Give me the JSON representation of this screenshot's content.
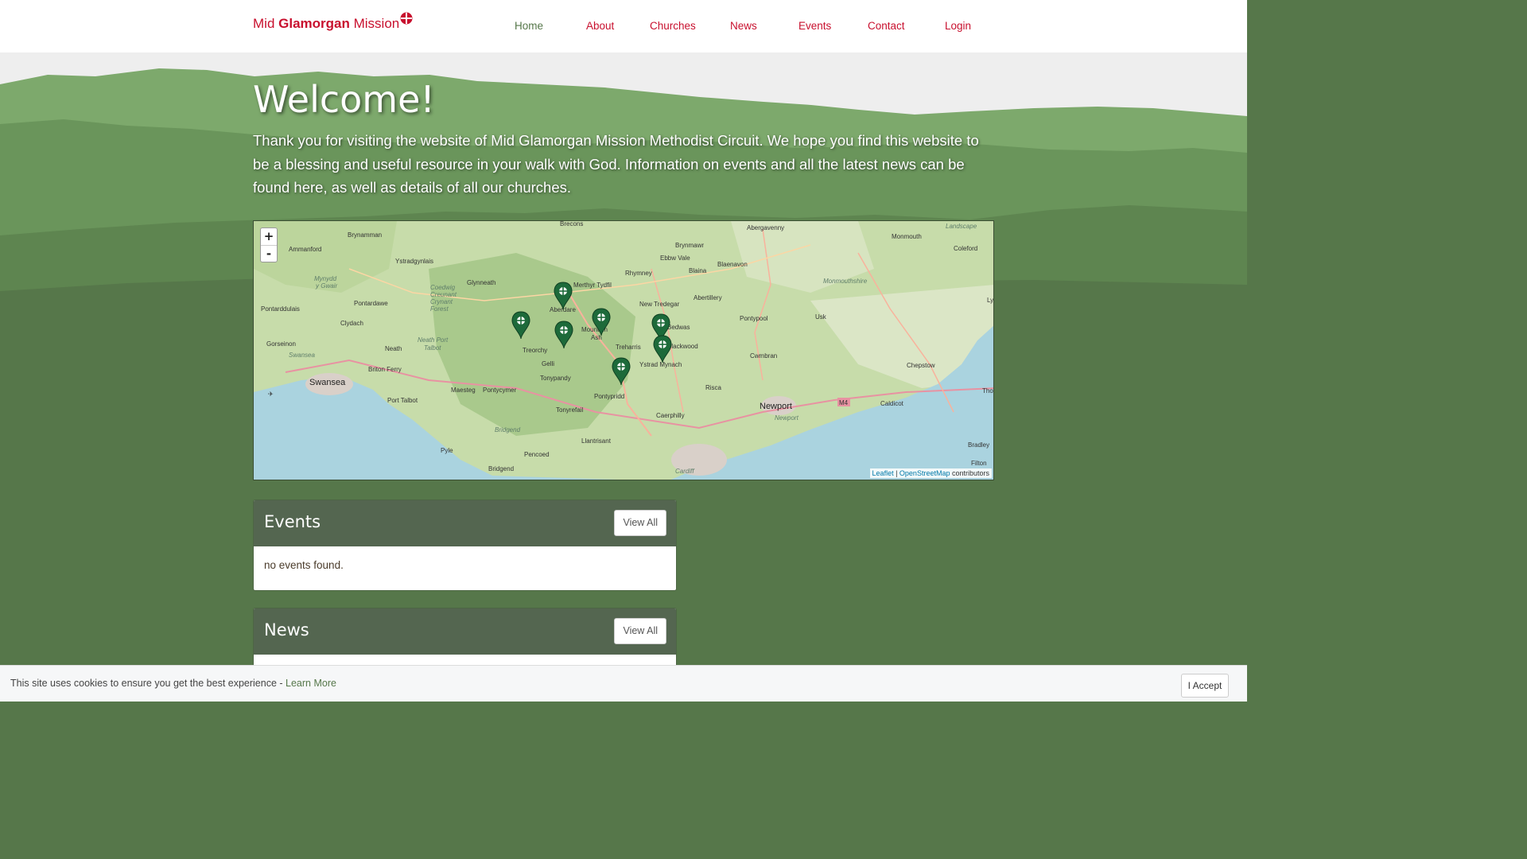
{
  "brand": {
    "prefix": "Mid ",
    "bold": "Glamorgan",
    "suffix": " Mission",
    "color": "#c8102e",
    "icon": "methodist-cross-icon"
  },
  "nav": {
    "items": [
      {
        "label": "Home",
        "active": true
      },
      {
        "label": "About"
      },
      {
        "label": "Churches"
      },
      {
        "label": "News"
      },
      {
        "label": "Events"
      },
      {
        "label": "Contact"
      },
      {
        "label": "Login"
      }
    ]
  },
  "hero": {
    "title": "Welcome!",
    "intro": "Thank you for visiting the website of Mid Glamorgan Mission Methodist Circuit. We hope you find this website to be a blessing and useful resource in your walk with God. Information on events and all the latest news can be found here, as well as details of all our churches."
  },
  "map": {
    "zoom_in": "+",
    "zoom_out": "-",
    "attribution": {
      "leaflet": "Leaflet",
      "separator": " | ",
      "osm": "OpenStreetMap",
      "suffix": " contributors"
    },
    "places": [
      "Brynamman",
      "Ammanford",
      "Ystradgynlais",
      "Glynneath",
      "Merthyr Tydfil",
      "Brynmawr",
      "Abergavenny",
      "Monmouth",
      "Coleford",
      "Landscape",
      "Rhymney",
      "Ebbw Vale",
      "Blaenavon",
      "Blaina",
      "Abertillery",
      "New Tredegar",
      "Pontypool",
      "Usk",
      "Monmouthshire",
      "Pontardawe",
      "Clydach",
      "Pontarddulais",
      "Aberdare",
      "Mountain Ash",
      "Treorchy",
      "Gelli",
      "Tonypandy",
      "Treharris",
      "Ystrad Mynach",
      "Blackwood",
      "Bedwas",
      "Cwmbran",
      "Chepstow",
      "Gorseinon",
      "Neath",
      "Briton Ferry",
      "Swansea",
      "Port Talbot",
      "Maesteg",
      "Pontycymer",
      "Pontypridd",
      "Tonyrefail",
      "Risca",
      "Newport",
      "Caerphilly",
      "Caldicot",
      "M4",
      "Llantrisant",
      "Pyle",
      "Pencoed",
      "Bridgend",
      "Bradley",
      "Filton",
      "Cardiff",
      "Mynydd y Gwair",
      "Coedwig Creunant Crynant Forest",
      "Neath Port Talbot",
      "Swansea",
      "Bridgend",
      "Newport",
      "Tho",
      "Ly",
      "Brecons"
    ],
    "marker_count": 8
  },
  "events": {
    "title": "Events",
    "view_all": "View All",
    "empty": "no events found."
  },
  "news": {
    "title": "News",
    "view_all": "View All"
  },
  "cookie": {
    "text": "This site uses cookies to ensure you get the best experience - ",
    "link": "Learn More",
    "accept": "I Accept"
  },
  "colors": {
    "green": "#56774a",
    "red": "#c8102e",
    "card_header": "#546650"
  }
}
